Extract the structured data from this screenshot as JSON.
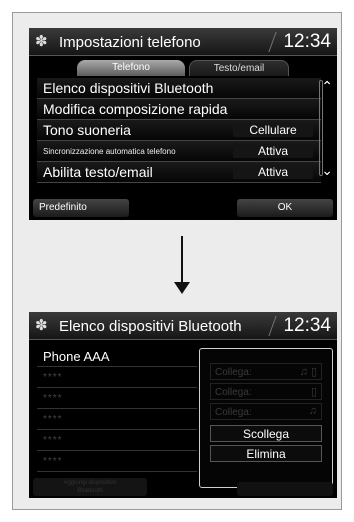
{
  "screen1": {
    "title": "Impostazioni telefono",
    "clock": "12:34",
    "tabs": [
      {
        "label": "Telefono",
        "active": true
      },
      {
        "label": "Testo/email",
        "active": false
      }
    ],
    "items": [
      {
        "label": "Elenco dispositivi Bluetooth",
        "value": ""
      },
      {
        "label": "Modifica composizione rapida",
        "value": ""
      },
      {
        "label": "Tono suoneria",
        "value": "Cellulare"
      },
      {
        "label": "Sincronizzazione automatica telefono",
        "value": "Attiva"
      },
      {
        "label": "Abilita testo/email",
        "value": "Attiva"
      }
    ],
    "footer": {
      "left": "Predefinito",
      "right": "OK"
    }
  },
  "screen2": {
    "title": "Elenco dispositivi Bluetooth",
    "clock": "12:34",
    "devices": [
      "Phone AAA",
      "****",
      "****",
      "****",
      "****",
      "****"
    ],
    "popup": {
      "connect_rows": [
        {
          "label": "Collega:",
          "icon": "♫ ▯"
        },
        {
          "label": "Collega:",
          "icon": "▯"
        },
        {
          "label": "Collega:",
          "icon": "♫"
        }
      ],
      "disconnect": "Scollega",
      "delete": "Elimina"
    },
    "add_device_line1": "Aggiungi dispositivo",
    "add_device_line2": "Bluetooth"
  },
  "icons": {
    "settings": "gear-icon",
    "scroll_up": "double-chevron-up-icon",
    "scroll_down": "double-chevron-down-icon",
    "music": "music-note-icon",
    "phone": "phone-icon",
    "arrow": "arrow-down-icon"
  }
}
